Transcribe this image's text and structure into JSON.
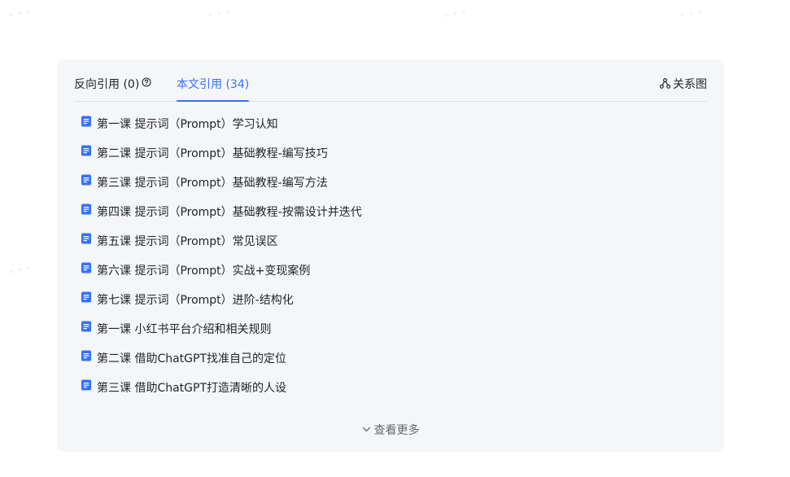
{
  "tabs": {
    "back_label": "反向引用 (0)",
    "ref_label": "本文引用 (34)"
  },
  "relation_button": "关系图",
  "items": [
    "第一课 提示词（Prompt）学习认知",
    "第二课 提示词（Prompt）基础教程-编写技巧",
    "第三课 提示词（Prompt）基础教程-编写方法",
    "第四课 提示词（Prompt）基础教程-按需设计并迭代",
    "第五课 提示词（Prompt）常见误区",
    "第六课 提示词（Prompt）实战+变现案例",
    "第七课 提示词（Prompt）进阶-结构化",
    "第一课 小红书平台介绍和相关规则",
    "第二课 借助ChatGPT找准自己的定位",
    "第三课 借助ChatGPT打造清晰的人设"
  ],
  "more_label": "查看更多",
  "colors": {
    "accent": "#3370ff",
    "doc_icon": "#3370ff",
    "text": "#1f2329",
    "panel_bg": "#f5f6f7"
  }
}
